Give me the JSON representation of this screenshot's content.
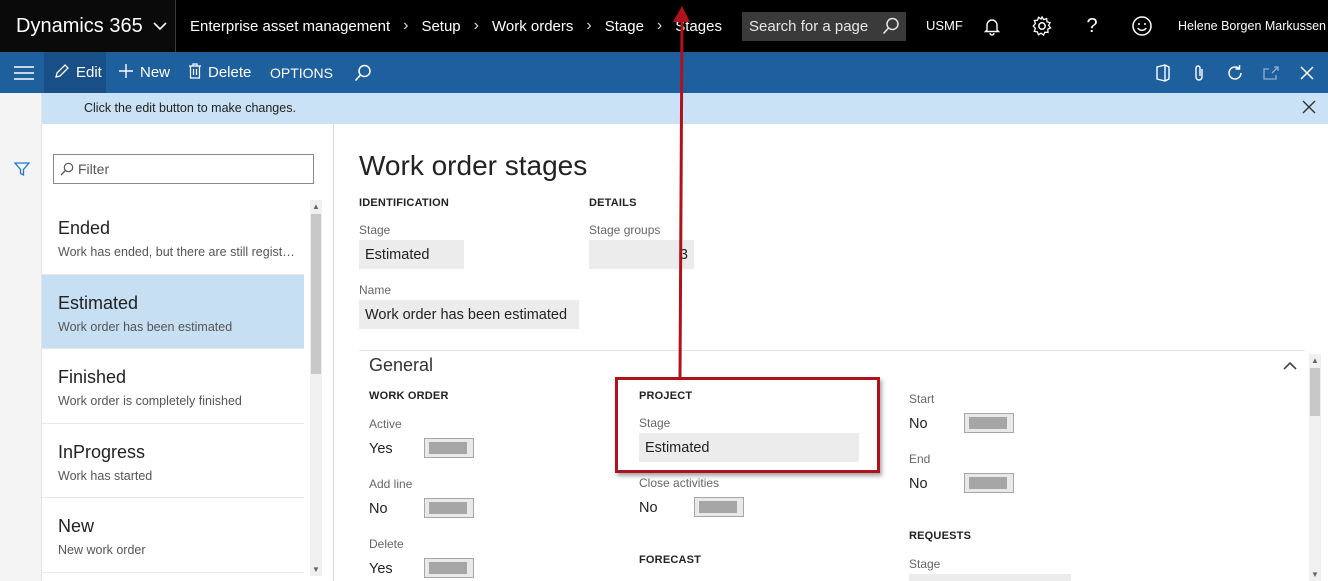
{
  "topbar": {
    "brand": "Dynamics 365",
    "breadcrumb": [
      "Enterprise asset management",
      "Setup",
      "Work orders",
      "Stage",
      "Stages"
    ],
    "search_placeholder": "Search for a page",
    "company": "USMF",
    "user": "Helene Borgen Markussen",
    "icons": [
      "bell-icon",
      "gear-icon",
      "help-icon",
      "smiley-icon"
    ]
  },
  "actionbar": {
    "edit": "Edit",
    "new": "New",
    "delete": "Delete",
    "options": "OPTIONS",
    "right_icons": [
      "office-icon",
      "attach-icon",
      "refresh-icon",
      "popout-icon",
      "close-icon"
    ]
  },
  "message": "Click the edit button to make changes.",
  "list": {
    "filter_placeholder": "Filter",
    "items": [
      {
        "name": "Ended",
        "desc": "Work has ended, but there are still registrations"
      },
      {
        "name": "Estimated",
        "desc": "Work order has been estimated",
        "selected": true
      },
      {
        "name": "Finished",
        "desc": "Work order is completely finished"
      },
      {
        "name": "InProgress",
        "desc": "Work has started"
      },
      {
        "name": "New",
        "desc": "New work order"
      }
    ]
  },
  "form": {
    "title": "Work order stages",
    "identification": {
      "header": "IDENTIFICATION",
      "stage_label": "Stage",
      "stage_value": "Estimated",
      "name_label": "Name",
      "name_value": "Work order has been estimated"
    },
    "details": {
      "header": "DETAILS",
      "stage_groups_label": "Stage groups",
      "stage_groups_value": "3"
    },
    "general": {
      "title": "General",
      "work_order": {
        "header": "WORK ORDER",
        "active_label": "Active",
        "active_value": "Yes",
        "add_line_label": "Add line",
        "add_line_value": "No",
        "delete_label": "Delete",
        "delete_value": "Yes"
      },
      "project": {
        "header": "PROJECT",
        "stage_label": "Stage",
        "stage_value": "Estimated",
        "close_activities_label": "Close activities",
        "close_activities_value": "No"
      },
      "forecast": {
        "header": "FORECAST"
      },
      "timing": {
        "start_label": "Start",
        "start_value": "No",
        "end_label": "End",
        "end_value": "No"
      },
      "requests": {
        "header": "REQUESTS",
        "stage_label": "Stage"
      }
    }
  },
  "colors": {
    "topbar": "#000000",
    "actionbar": "#1e5f9e",
    "message_bar": "#c9e2f5",
    "selection": "#c6dff3",
    "annotation": "#b0121d"
  }
}
